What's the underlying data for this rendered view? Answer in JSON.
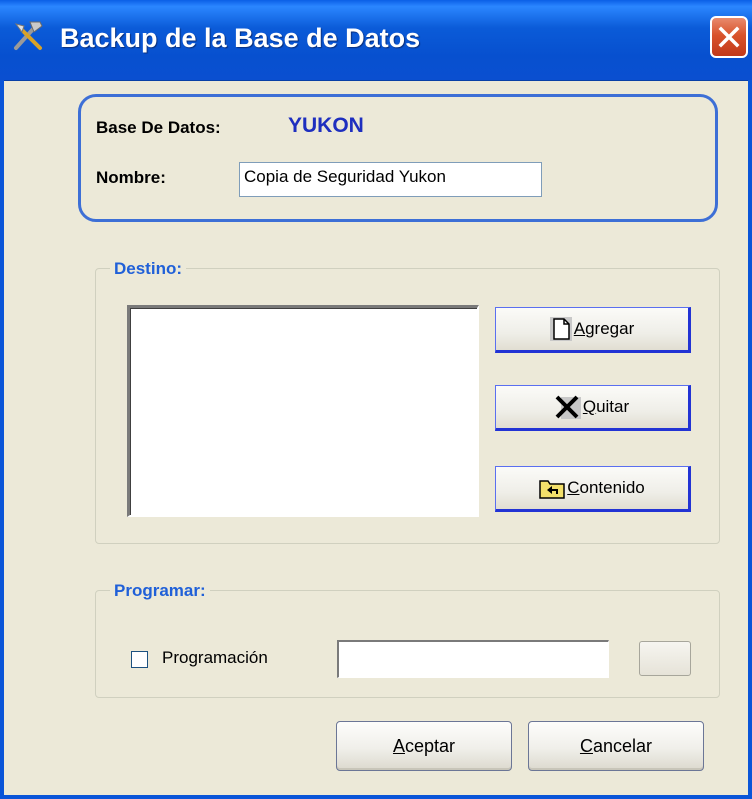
{
  "window": {
    "title": "Backup de la Base de Datos",
    "close_icon": "close-icon",
    "app_icon": "tools-icon"
  },
  "database": {
    "label": "Base De Datos:",
    "value": "YUKON",
    "name_label": "Nombre:",
    "name_value": "Copia de Seguridad Yukon"
  },
  "destino": {
    "title": "Destino:",
    "items": [],
    "buttons": {
      "add": {
        "icon": "new-document-icon",
        "first": "A",
        "rest": "gregar"
      },
      "remove": {
        "icon": "x-icon",
        "first": "Q",
        "rest": "uitar"
      },
      "contents": {
        "icon": "folder-up-icon",
        "first": "C",
        "rest": "ontenido"
      }
    }
  },
  "programar": {
    "title": "Programar:",
    "checkbox_label": "Programación",
    "checked": false,
    "schedule_value": ""
  },
  "footer": {
    "ok": {
      "first": "A",
      "rest": "ceptar"
    },
    "cancel": {
      "first": "C",
      "rest": "ancelar"
    }
  },
  "colors": {
    "titlebar": "#0a5fe6",
    "panel_border": "#3d6fd6",
    "db_name": "#1e2fbf",
    "group_title": "#2060d8",
    "button_focus": "#2233d4",
    "background": "#ece9d8"
  }
}
